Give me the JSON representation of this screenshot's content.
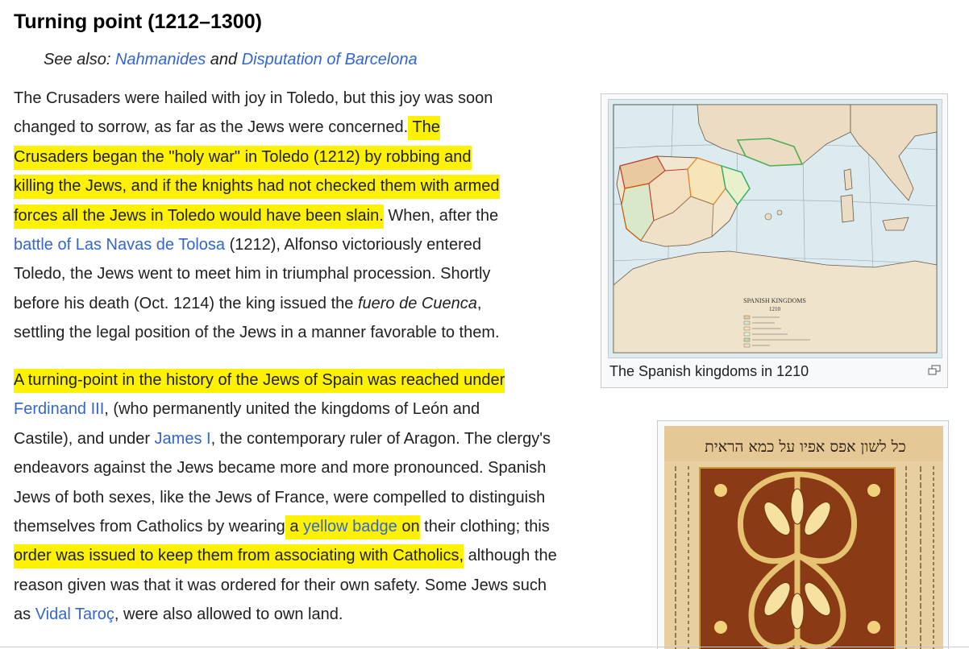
{
  "section": {
    "title": "Turning point (1212–1300)"
  },
  "hatnote": {
    "prefix": "See also: ",
    "link1": "Nahmanides",
    "mid": " and ",
    "link2": "Disputation of Barcelona"
  },
  "paragraph1": {
    "l1": "The Crusaders were hailed with joy in Toledo, but this joy was soon",
    "l2_plain": "changed to sorrow, as far as the Jews were concerned.",
    "l2_hl": " The",
    "l3_hl": "Crusaders began the \"holy war\" in Toledo (1212) by robbing and",
    "l4_hl": "killing the Jews, and if the knights had not checked them with armed",
    "l5_hl": "forces all the Jews in Toledo would have been slain.",
    "l5_plain": " When, after the",
    "l6_link": "battle of Las Navas de Tolosa",
    "l6_plain": " (1212), Alfonso victoriously entered",
    "l7": "Toledo, the Jews went to meet him in triumphal procession. Shortly",
    "l8_pre": "before his death (Oct. 1214) the king issued the ",
    "l8_em": "fuero de Cuenca",
    "l8_post": ",",
    "l9": "settling the legal position of the Jews in a manner favorable to them."
  },
  "paragraph2": {
    "l1_hl": "A turning-point in the history of the Jews of Spain was reached under",
    "l2_link": "Ferdinand III",
    "l2_plain": ", (who permanently united the kingdoms of León and",
    "l3_pre": "Castile), and under ",
    "l3_link": "James I",
    "l3_post": ", the contemporary ruler of Aragon. The clergy's",
    "l4": "endeavors against the Jews became more and more pronounced. Spanish",
    "l5": "Jews of both sexes, like the Jews of France, were compelled to distinguish",
    "l6_pre": "themselves from Catholics by wearing",
    "l6_hl_a": " a ",
    "l6_hl_link": "yellow badge",
    "l6_hl_b": " on",
    "l6_post": " their clothing; this",
    "l7_hl": "order was issued to keep them from associating with Catholics,",
    "l7_post": " although the",
    "l8": "reason given was that it was ordered for their own safety. Some Jews such",
    "l9_pre": "as ",
    "l9_link": "Vidal Taroç",
    "l9_post": ", were also allowed to own land."
  },
  "figure1": {
    "caption": "The Spanish kingdoms in 1210",
    "map_title": "SPANISH KINGDOMS",
    "map_year": "1210"
  },
  "figure2": {
    "hebrew_line": "כל לשון אפס אפיו על כמא הראית"
  },
  "colors": {
    "link": "#3366cc",
    "highlight": "#fff200",
    "text": "#202122"
  }
}
